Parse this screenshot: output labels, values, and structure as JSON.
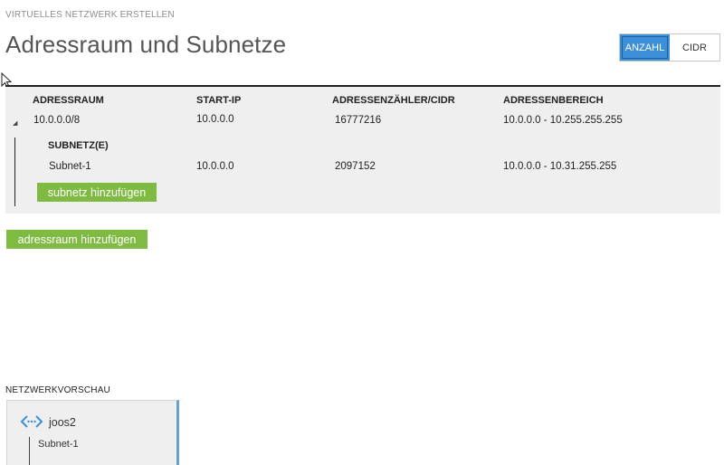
{
  "wizard": {
    "step_title": "VIRTUELLES NETZWERK ERSTELLEN"
  },
  "page": {
    "title": "Adressraum und Subnetze"
  },
  "toggle": {
    "anzahl_label": "ANZAHL",
    "cidr_label": "CIDR",
    "selected": "ANZAHL"
  },
  "table": {
    "headers": [
      "ADRESSRAUM",
      "START-IP",
      "ADRESSENZÄHLER/CIDR",
      "ADRESSENBEREICH"
    ],
    "address_space": {
      "address": "10.0.0.0/8",
      "start_ip": "10.0.0.0",
      "count": "16777216",
      "range": "10.0.0.0 - 10.255.255.255",
      "expanded": true
    },
    "subnets_header": "SUBNETZ(E)",
    "subnets": [
      {
        "name": "Subnet-1",
        "start_ip": "10.0.0.0",
        "count": "2097152",
        "range": "10.0.0.0 - 10.31.255.255"
      }
    ],
    "add_subnet_label": "subnetz hinzufügen"
  },
  "add_address_space_label": "adressraum hinzufügen",
  "preview": {
    "label": "NETZWERKVORSCHAU",
    "network_name": "joos2",
    "subnet_name": "Subnet-1"
  },
  "colors": {
    "accent_blue": "#3d8fd8",
    "button_green": "#7fba42",
    "panel_gray": "#efefef"
  }
}
